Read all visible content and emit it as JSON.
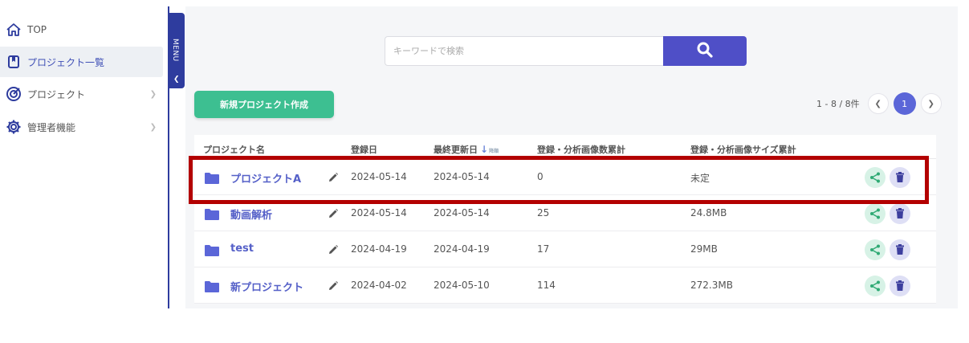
{
  "sidebar": {
    "items": [
      {
        "label": "TOP",
        "icon": "home-icon"
      },
      {
        "label": "プロジェクト一覧",
        "icon": "project-list-icon",
        "active": true
      },
      {
        "label": "プロジェクト",
        "icon": "target-icon"
      },
      {
        "label": "管理者機能",
        "icon": "gear-icon"
      }
    ],
    "menu_tab_label": "MENU"
  },
  "search": {
    "placeholder": "キーワードで検索"
  },
  "new_project_button": "新規プロジェクト作成",
  "pagination": {
    "count_text": "1 - 8 / 8件",
    "current_page": "1"
  },
  "table": {
    "headers": {
      "name": "プロジェクト名",
      "registered": "登録日",
      "updated": "最終更新日",
      "updated_sort_sub": "降順",
      "image_count": "登録・分析画像数累計",
      "image_size": "登録・分析画像サイズ累計"
    },
    "rows": [
      {
        "name": "プロジェクトA",
        "registered": "2024-05-14",
        "updated": "2024-05-14",
        "count": "0",
        "size": "未定"
      },
      {
        "name": "動画解析",
        "registered": "2024-05-14",
        "updated": "2024-05-14",
        "count": "25",
        "size": "24.8MB"
      },
      {
        "name": "test",
        "registered": "2024-04-19",
        "updated": "2024-04-19",
        "count": "17",
        "size": "29MB"
      },
      {
        "name": "新プロジェクト",
        "registered": "2024-04-02",
        "updated": "2024-05-10",
        "count": "114",
        "size": "272.3MB"
      }
    ]
  },
  "colors": {
    "accent": "#4f4fc7",
    "green": "#3dbf91",
    "highlight": "#b30000",
    "nav": "#2e3c9e"
  }
}
